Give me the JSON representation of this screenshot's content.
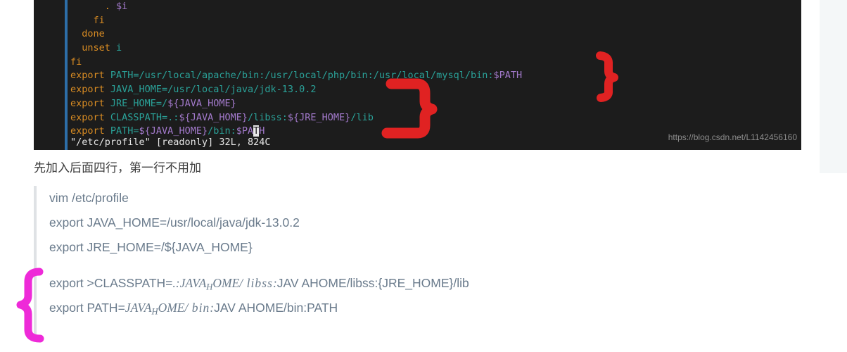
{
  "terminal": {
    "file": "/etc/profile",
    "status_line": "\"/etc/profile\" [readonly] 32L, 824C",
    "watermark": "https://blog.csdn.net/L1142456160",
    "colors": {
      "background": "#1c1c1c",
      "keyword": "#d98c23",
      "value": "#2aa198",
      "variable": "#a37acc",
      "scrollbar": "#2d6ea8",
      "cursor": "#e8e8e8",
      "annotation_red": "#e02222"
    },
    "lines": [
      {
        "indent": "      ",
        "segments": [
          {
            "text": ". ",
            "cls": "c-dot"
          },
          {
            "text": "$i",
            "cls": "c-var"
          }
        ]
      },
      {
        "indent": "    ",
        "segments": [
          {
            "text": "fi",
            "cls": "c-key"
          }
        ]
      },
      {
        "indent": "  ",
        "segments": [
          {
            "text": "done",
            "cls": "c-key"
          }
        ]
      },
      {
        "indent": "  ",
        "segments": [
          {
            "text": "unset ",
            "cls": "c-key"
          },
          {
            "text": "i",
            "cls": "c-ident"
          }
        ]
      },
      {
        "indent": "",
        "segments": [
          {
            "text": "fi",
            "cls": "c-key"
          }
        ]
      },
      {
        "indent": "",
        "segments": [
          {
            "text": "export ",
            "cls": "c-key"
          },
          {
            "text": "PATH=/usr/local/apache/bin:/usr/local/php/bin:/usr/local/mysql/bin:",
            "cls": "c-path"
          },
          {
            "text": "$PATH",
            "cls": "c-var"
          }
        ]
      },
      {
        "indent": "",
        "segments": [
          {
            "text": "export ",
            "cls": "c-key"
          },
          {
            "text": "JAVA_HOME=/usr/local/java/jdk-13.0.2",
            "cls": "c-path"
          }
        ]
      },
      {
        "indent": "",
        "segments": [
          {
            "text": "export ",
            "cls": "c-key"
          },
          {
            "text": "JRE_HOME=/",
            "cls": "c-path"
          },
          {
            "text": "${JAVA_HOME}",
            "cls": "c-var"
          }
        ]
      },
      {
        "indent": "",
        "segments": [
          {
            "text": "export ",
            "cls": "c-key"
          },
          {
            "text": "CLASSPATH=.:",
            "cls": "c-path"
          },
          {
            "text": "${JAVA_HOME}",
            "cls": "c-var"
          },
          {
            "text": "/libss:",
            "cls": "c-path"
          },
          {
            "text": "${JRE_HOME}",
            "cls": "c-var"
          },
          {
            "text": "/lib",
            "cls": "c-path"
          }
        ]
      },
      {
        "indent": "",
        "segments": [
          {
            "text": "export ",
            "cls": "c-key"
          },
          {
            "text": "PATH=",
            "cls": "c-path"
          },
          {
            "text": "${JAVA_HOME}",
            "cls": "c-var"
          },
          {
            "text": "/bin:",
            "cls": "c-path"
          },
          {
            "text": "$PA",
            "cls": "c-var"
          },
          {
            "text": "T",
            "cls": "c-var cursor-blk"
          },
          {
            "text": "H",
            "cls": "c-var"
          }
        ]
      }
    ]
  },
  "caption": "先加入后面四行，第一行不用加",
  "quote": {
    "border_color": "#dfe2e5",
    "text_color": "#6a7b8c",
    "lines": [
      {
        "kind": "plain",
        "text": "vim /etc/profile"
      },
      {
        "kind": "plain",
        "text": "export JAVA_HOME=/usr/local/java/jdk-13.0.2"
      },
      {
        "kind": "plain",
        "text": "export JRE_HOME=/${JAVA_HOME}"
      },
      {
        "kind": "blank",
        "text": ""
      },
      {
        "kind": "math_classpath",
        "prefix": "export >CLASSPATH=",
        "math_a": ".:JAVA",
        "math_sub": "H",
        "math_b": "OME/",
        "math_c": "libss",
        "math_d": ":",
        "suffix": "JAV AHOME/libss:{JRE_HOME}/lib"
      },
      {
        "kind": "math_path",
        "prefix": "export PATH=",
        "math_a": "JAVA",
        "math_sub": "H",
        "math_b": "OME/",
        "math_c": "bin",
        "math_d": ":",
        "suffix": "JAV AHOME/bin:PATH"
      }
    ]
  },
  "annotations": {
    "red_brace_top": {
      "shape": "right-curly-brace",
      "color": "#e02222"
    },
    "red_brace_main": {
      "shape": "right-curly-brace",
      "color": "#e02222"
    },
    "magenta_brace": {
      "shape": "left-curly-brace",
      "color": "#ee2ad8"
    }
  }
}
